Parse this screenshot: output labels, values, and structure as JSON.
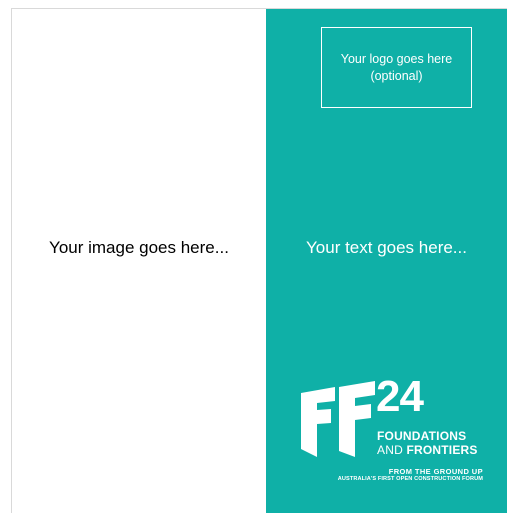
{
  "colors": {
    "accent": "#0fb0a7",
    "panel_text": "#ffffff",
    "left_background": "#ffffff"
  },
  "left": {
    "image_placeholder": "Your image goes here..."
  },
  "right": {
    "logo_placeholder_line1": "Your logo goes here",
    "logo_placeholder_line2": "(optional)",
    "text_placeholder": "Your text goes here..."
  },
  "brand": {
    "mark": "FF",
    "year": "24",
    "line1": "FOUNDATIONS",
    "line2_prefix": "AND ",
    "line2_bold": "FRONTIERS",
    "tagline": "FROM THE GROUND UP",
    "subtagline": "AUSTRALIA'S FIRST OPEN CONSTRUCTION FORUM"
  }
}
